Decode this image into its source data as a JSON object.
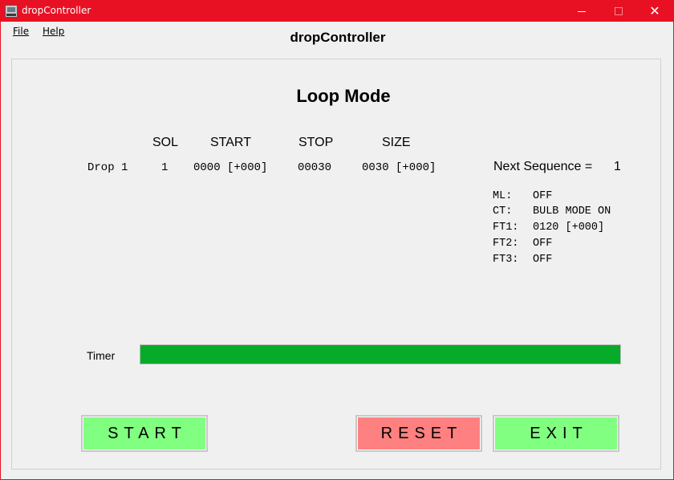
{
  "window": {
    "title": "dropController",
    "accent_color": "#e81123",
    "controls": {
      "minimize_icon": "minimize-icon",
      "maximize_icon": "maximize-icon",
      "close_glyph": "✕"
    }
  },
  "menu": {
    "file": "File",
    "help": "Help"
  },
  "app_title": "dropController",
  "mode_title": "Loop Mode",
  "table": {
    "headers": {
      "sol": "SOL",
      "start": "START",
      "stop": "STOP",
      "size": "SIZE"
    },
    "rows": [
      {
        "name": "Drop 1",
        "sol": "1",
        "start": "0000 [+000]",
        "stop": "00030",
        "size": "0030 [+000]"
      }
    ]
  },
  "next_sequence": {
    "label": "Next Sequence =",
    "value": "1"
  },
  "status": [
    {
      "key": "ML:",
      "value": "OFF"
    },
    {
      "key": "CT:",
      "value": "BULB MODE ON"
    },
    {
      "key": "FT1:",
      "value": "0120 [+000]"
    },
    {
      "key": "FT2:",
      "value": "OFF"
    },
    {
      "key": "FT3:",
      "value": "OFF"
    }
  ],
  "timer": {
    "label": "Timer",
    "progress_fraction": 1.0,
    "color": "#06ab2a"
  },
  "buttons": {
    "start": {
      "label": "START",
      "color": "#80ff80"
    },
    "reset": {
      "label": "RESET",
      "color": "#ff8080"
    },
    "exit": {
      "label": "EXIT",
      "color": "#80ff80"
    }
  }
}
